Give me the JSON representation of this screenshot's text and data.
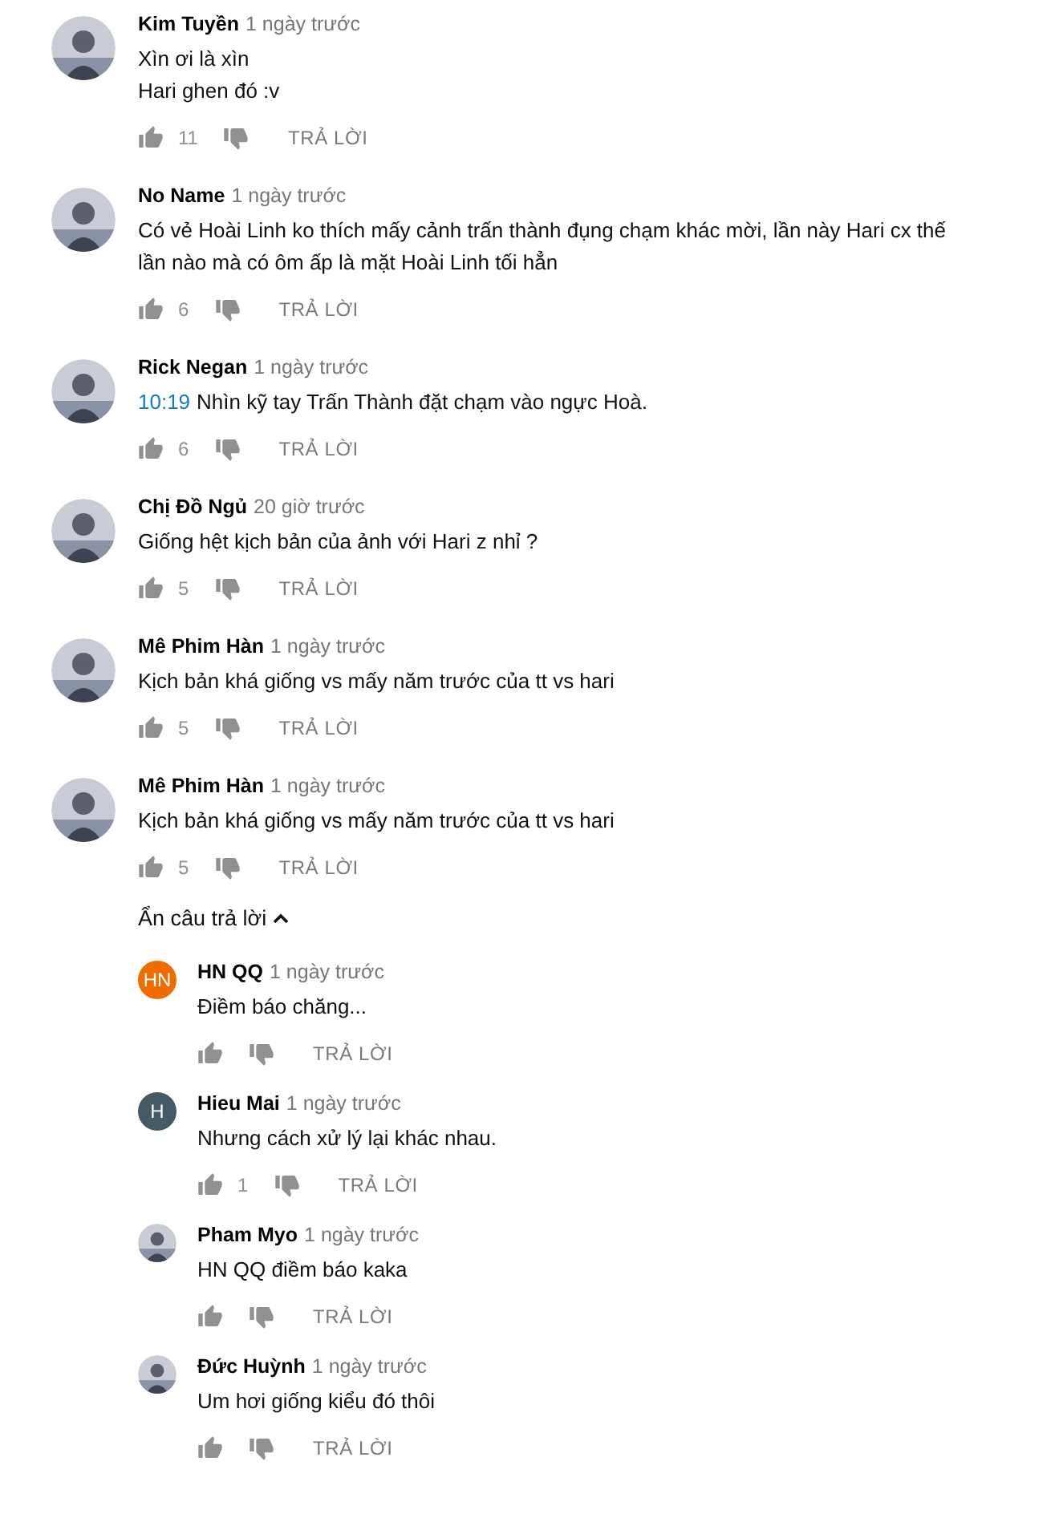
{
  "comments": [
    {
      "author": "Kim Tuyền",
      "time": "1 ngày trước",
      "avatar": {
        "kind": "picture"
      },
      "lines": [
        "Xìn ơi là xìn",
        "Hari ghen đó :v"
      ],
      "likes": "11",
      "reply_label": "TRẢ LỜI"
    },
    {
      "author": "No Name",
      "time": "1 ngày trước",
      "avatar": {
        "kind": "picture"
      },
      "lines": [
        "Có vẻ Hoài Linh ko thích mấy cảnh trấn thành đụng chạm khác mời, lần này Hari cx thế",
        "lần nào mà có ôm ấp là mặt Hoài Linh tối hẳn"
      ],
      "likes": "6",
      "reply_label": "TRẢ LỜI"
    },
    {
      "author": "Rick Negan",
      "time": "1 ngày trước",
      "avatar": {
        "kind": "picture"
      },
      "timestamp": "10:19",
      "lines": [
        "Nhìn kỹ tay Trấn Thành đặt chạm vào ngực Hoà."
      ],
      "likes": "6",
      "reply_label": "TRẢ LỜI"
    },
    {
      "author": "Chị Đồ Ngủ",
      "time": "20 giờ trước",
      "avatar": {
        "kind": "picture"
      },
      "lines": [
        "Giống hệt kịch bản của ảnh với Hari z nhỉ ?"
      ],
      "likes": "5",
      "reply_label": "TRẢ LỜI"
    },
    {
      "author": "Mê Phim Hàn",
      "time": "1 ngày trước",
      "avatar": {
        "kind": "picture"
      },
      "lines": [
        "Kịch bản khá giống vs mấy năm trước của tt vs hari"
      ],
      "likes": "5",
      "reply_label": "TRẢ LỜI"
    },
    {
      "author": "Mê Phim Hàn",
      "time": "1 ngày trước",
      "avatar": {
        "kind": "picture"
      },
      "lines": [
        "Kịch bản khá giống vs mấy năm trước của tt vs hari"
      ],
      "likes": "5",
      "reply_label": "TRẢ LỜI",
      "replies_toggle": {
        "label": "Ẩn câu trả lời",
        "expanded": true
      },
      "replies": [
        {
          "author": "HN QQ",
          "time": "1 ngày trước",
          "avatar": {
            "kind": "letter",
            "text": "HN",
            "color": "#ef6c00"
          },
          "lines": [
            "Điềm báo chăng..."
          ],
          "reply_label": "TRẢ LỜI"
        },
        {
          "author": "Hieu Mai",
          "time": "1 ngày trước",
          "avatar": {
            "kind": "letter",
            "text": "H",
            "color": "#455a64"
          },
          "lines": [
            "Nhưng cách xử lý lại khác nhau."
          ],
          "likes": "1",
          "reply_label": "TRẢ LỜI"
        },
        {
          "author": "Pham Myo",
          "time": "1 ngày trước",
          "avatar": {
            "kind": "picture"
          },
          "lines": [
            "HN QQ điềm báo kaka"
          ],
          "reply_label": "TRẢ LỜI"
        },
        {
          "author": "Đức Huỳnh",
          "time": "1 ngày trước",
          "avatar": {
            "kind": "picture"
          },
          "lines": [
            "Um hơi giống kiểu đó thôi"
          ],
          "reply_label": "TRẢ LỜI"
        }
      ]
    }
  ]
}
